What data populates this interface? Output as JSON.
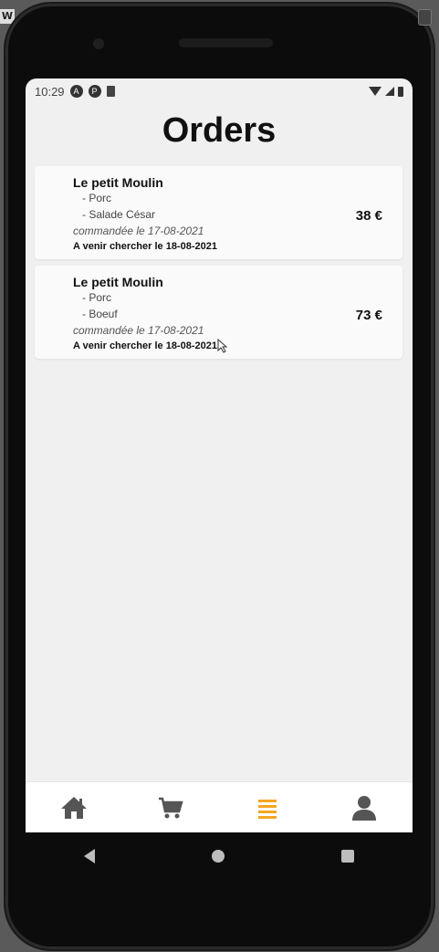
{
  "window_badge": "W",
  "status": {
    "time": "10:29"
  },
  "page": {
    "title": "Orders"
  },
  "orders": [
    {
      "restaurant": "Le petit Moulin",
      "items": [
        "- Porc",
        "- Salade César"
      ],
      "ordered": "commandée le 17-08-2021",
      "pickup": "A venir chercher le 18-08-2021",
      "price": "38 €"
    },
    {
      "restaurant": "Le petit Moulin",
      "items": [
        "- Porc",
        "- Boeuf"
      ],
      "ordered": "commandée le 17-08-2021",
      "pickup": "A venir chercher le 18-08-2021",
      "price": "73 €"
    }
  ],
  "nav": [
    {
      "icon": "home-icon",
      "active": false
    },
    {
      "icon": "cart-icon",
      "active": false
    },
    {
      "icon": "list-icon",
      "active": true
    },
    {
      "icon": "user-icon",
      "active": false
    }
  ],
  "colors": {
    "accent": "#f5a623",
    "icon_inactive": "#555555"
  }
}
